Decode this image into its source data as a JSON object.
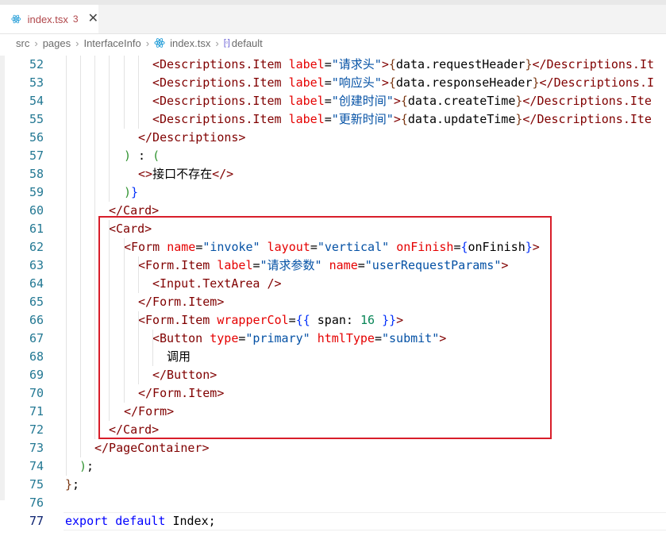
{
  "tab": {
    "title": "index.tsx",
    "badge": "3",
    "icon": "react-icon"
  },
  "breadcrumb": [
    "src",
    "pages",
    "InterfaceInfo",
    "index.tsx",
    "default"
  ],
  "code": [
    {
      "n": "52",
      "t": [
        [
          "tag",
          "<Descriptions.Item "
        ],
        [
          "attr",
          "label"
        ],
        [
          "txt",
          "="
        ],
        [
          "str",
          "\"请求头\""
        ],
        [
          "tag",
          ">"
        ],
        [
          "br3",
          "{"
        ],
        [
          "txt",
          "data.requestHeader"
        ],
        [
          "br3",
          "}"
        ],
        [
          "tag",
          "</Descriptions.It"
        ]
      ]
    },
    {
      "n": "53",
      "t": [
        [
          "tag",
          "<Descriptions.Item "
        ],
        [
          "attr",
          "label"
        ],
        [
          "txt",
          "="
        ],
        [
          "str",
          "\"响应头\""
        ],
        [
          "tag",
          ">"
        ],
        [
          "br3",
          "{"
        ],
        [
          "txt",
          "data.responseHeader"
        ],
        [
          "br3",
          "}"
        ],
        [
          "tag",
          "</Descriptions.I"
        ]
      ]
    },
    {
      "n": "54",
      "t": [
        [
          "tag",
          "<Descriptions.Item "
        ],
        [
          "attr",
          "label"
        ],
        [
          "txt",
          "="
        ],
        [
          "str",
          "\"创建时间\""
        ],
        [
          "tag",
          ">"
        ],
        [
          "br3",
          "{"
        ],
        [
          "txt",
          "data.createTime"
        ],
        [
          "br3",
          "}"
        ],
        [
          "tag",
          "</Descriptions.Ite"
        ]
      ]
    },
    {
      "n": "55",
      "t": [
        [
          "tag",
          "<Descriptions.Item "
        ],
        [
          "attr",
          "label"
        ],
        [
          "txt",
          "="
        ],
        [
          "str",
          "\"更新时间\""
        ],
        [
          "tag",
          ">"
        ],
        [
          "br3",
          "{"
        ],
        [
          "txt",
          "data.updateTime"
        ],
        [
          "br3",
          "}"
        ],
        [
          "tag",
          "</Descriptions.Ite"
        ]
      ]
    },
    {
      "n": "56",
      "t": [
        [
          "tag",
          "</Descriptions>"
        ]
      ]
    },
    {
      "n": "57",
      "t": [
        [
          "br2",
          ")"
        ],
        [
          "txt",
          " : "
        ],
        [
          "br2",
          "("
        ]
      ]
    },
    {
      "n": "58",
      "t": [
        [
          "tag",
          "<>"
        ],
        [
          "txt",
          "接口不存在"
        ],
        [
          "tag",
          "</>"
        ]
      ]
    },
    {
      "n": "59",
      "t": [
        [
          "br2",
          ")"
        ],
        [
          "br1",
          "}"
        ]
      ]
    },
    {
      "n": "60",
      "t": [
        [
          "tag",
          "</Card>"
        ]
      ]
    },
    {
      "n": "61",
      "t": [
        [
          "tag",
          "<Card>"
        ]
      ]
    },
    {
      "n": "62",
      "t": [
        [
          "tag",
          "<Form "
        ],
        [
          "attr",
          "name"
        ],
        [
          "txt",
          "="
        ],
        [
          "str",
          "\"invoke\""
        ],
        [
          "txt",
          " "
        ],
        [
          "attr",
          "layout"
        ],
        [
          "txt",
          "="
        ],
        [
          "str",
          "\"vertical\""
        ],
        [
          "txt",
          " "
        ],
        [
          "attr",
          "onFinish"
        ],
        [
          "txt",
          "="
        ],
        [
          "br1",
          "{"
        ],
        [
          "txt",
          "onFinish"
        ],
        [
          "br1",
          "}"
        ],
        [
          "tag",
          ">"
        ]
      ]
    },
    {
      "n": "63",
      "t": [
        [
          "tag",
          "<Form.Item "
        ],
        [
          "attr",
          "label"
        ],
        [
          "txt",
          "="
        ],
        [
          "str",
          "\"请求参数\""
        ],
        [
          "txt",
          " "
        ],
        [
          "attr",
          "name"
        ],
        [
          "txt",
          "="
        ],
        [
          "str",
          "\"userRequestParams\""
        ],
        [
          "tag",
          ">"
        ]
      ]
    },
    {
      "n": "64",
      "t": [
        [
          "tag",
          "<Input.TextArea />"
        ]
      ]
    },
    {
      "n": "65",
      "t": [
        [
          "tag",
          "</Form.Item>"
        ]
      ]
    },
    {
      "n": "66",
      "t": [
        [
          "tag",
          "<Form.Item "
        ],
        [
          "attr",
          "wrapperCol"
        ],
        [
          "txt",
          "="
        ],
        [
          "br1",
          "{{"
        ],
        [
          "txt",
          " span: "
        ],
        [
          "num",
          "16"
        ],
        [
          "txt",
          " "
        ],
        [
          "br1",
          "}}"
        ],
        [
          "tag",
          ">"
        ]
      ]
    },
    {
      "n": "67",
      "t": [
        [
          "tag",
          "<Button "
        ],
        [
          "attr",
          "type"
        ],
        [
          "txt",
          "="
        ],
        [
          "str",
          "\"primary\""
        ],
        [
          "txt",
          " "
        ],
        [
          "attr",
          "htmlType"
        ],
        [
          "txt",
          "="
        ],
        [
          "str",
          "\"submit\""
        ],
        [
          "tag",
          ">"
        ]
      ]
    },
    {
      "n": "68",
      "t": [
        [
          "txt",
          "调用"
        ]
      ]
    },
    {
      "n": "69",
      "t": [
        [
          "tag",
          "</Button>"
        ]
      ]
    },
    {
      "n": "70",
      "t": [
        [
          "tag",
          "</Form.Item>"
        ]
      ]
    },
    {
      "n": "71",
      "t": [
        [
          "tag",
          "</Form>"
        ]
      ]
    },
    {
      "n": "72",
      "t": [
        [
          "tag",
          "</Card>"
        ]
      ]
    },
    {
      "n": "73",
      "t": [
        [
          "tag",
          "</PageContainer>"
        ]
      ]
    },
    {
      "n": "74",
      "t": [
        [
          "br2",
          ")"
        ],
        [
          "txt",
          ";"
        ]
      ]
    },
    {
      "n": "75",
      "t": [
        [
          "br3",
          "}"
        ],
        [
          "txt",
          ";"
        ]
      ]
    },
    {
      "n": "76",
      "t": []
    },
    {
      "n": "77",
      "t": [
        [
          "kw",
          "export"
        ],
        [
          "txt",
          " "
        ],
        [
          "kw",
          "default"
        ],
        [
          "txt",
          " Index;"
        ]
      ]
    }
  ],
  "active_line": "77"
}
